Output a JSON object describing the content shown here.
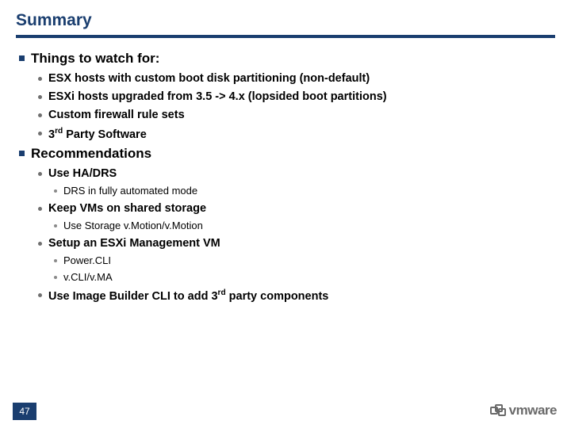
{
  "title": "Summary",
  "page_number": "47",
  "logo_text": "vmware",
  "sections": [
    {
      "heading": "Things to watch for:",
      "items": [
        {
          "text": "ESX hosts with custom boot disk partitioning (non-default)"
        },
        {
          "text": "ESXi hosts upgraded from 3.5 -> 4.x (lopsided boot partitions)"
        },
        {
          "text": "Custom firewall rule sets"
        },
        {
          "text_html": "3<span class='sup'>rd</span> Party Software"
        }
      ]
    },
    {
      "heading": "Recommendations",
      "items": [
        {
          "text": "Use HA/DRS",
          "sub": [
            {
              "text": "DRS in fully automated mode"
            }
          ]
        },
        {
          "text": "Keep VMs on shared storage",
          "sub": [
            {
              "text": "Use Storage v.Motion/v.Motion"
            }
          ]
        },
        {
          "text": "Setup an ESXi Management VM",
          "sub": [
            {
              "text": "Power.CLI"
            },
            {
              "text": "v.CLI/v.MA"
            }
          ]
        },
        {
          "text_html": "Use Image Builder CLI to add 3<span class='sup'>rd</span> party components"
        }
      ]
    }
  ]
}
